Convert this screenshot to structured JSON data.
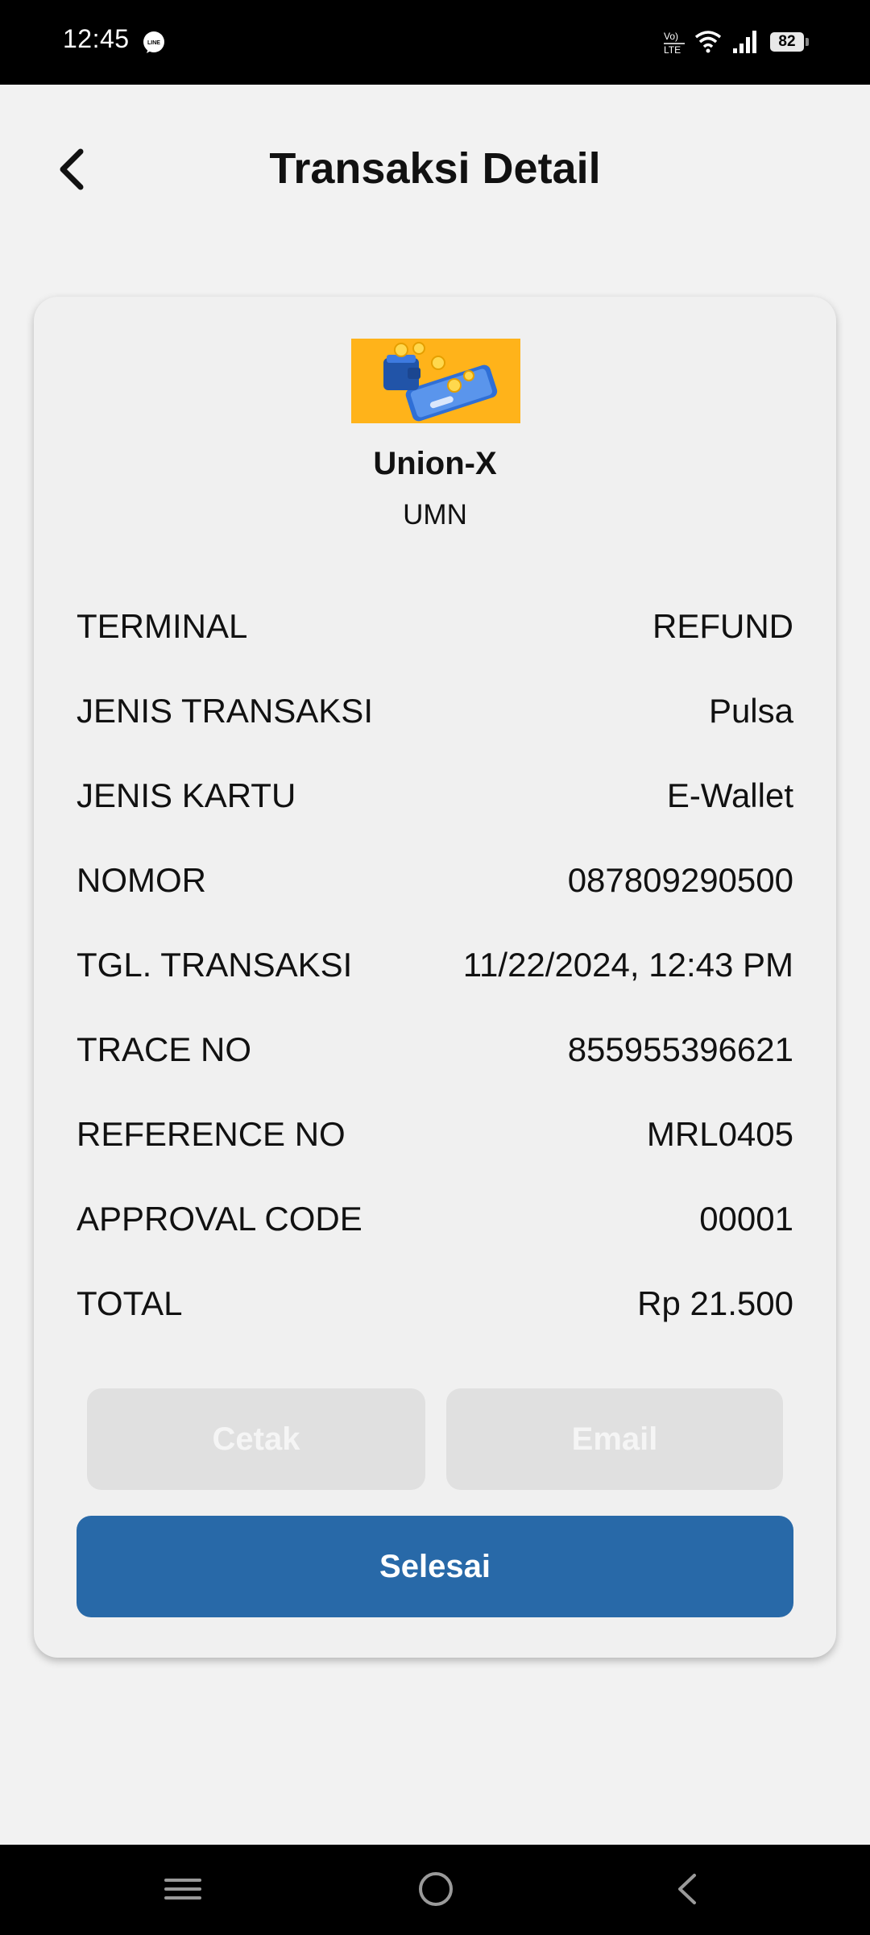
{
  "status_bar": {
    "time": "12:45",
    "battery": "82",
    "icons": [
      "line-app-icon",
      "volte-icon",
      "wifi-icon",
      "signal-icon",
      "battery-icon"
    ]
  },
  "header": {
    "title": "Transaksi Detail",
    "back_icon": "chevron-left-icon"
  },
  "merchant": {
    "name": "Union-X",
    "subtitle": "UMN",
    "logo": "wallet-phone-illustration"
  },
  "details": [
    {
      "label": "TERMINAL",
      "value": "REFUND"
    },
    {
      "label": "JENIS TRANSAKSI",
      "value": "Pulsa"
    },
    {
      "label": "JENIS KARTU",
      "value": "E-Wallet"
    },
    {
      "label": "NOMOR",
      "value": "087809290500"
    },
    {
      "label": "TGL. TRANSAKSI",
      "value": "11/22/2024, 12:43 PM"
    },
    {
      "label": "TRACE NO",
      "value": "855955396621"
    },
    {
      "label": "REFERENCE NO",
      "value": "MRL0405"
    },
    {
      "label": "APPROVAL CODE",
      "value": "00001"
    },
    {
      "label": "TOTAL",
      "value": "Rp 21.500"
    }
  ],
  "buttons": {
    "print": "Cetak",
    "email": "Email",
    "done": "Selesai"
  },
  "colors": {
    "primary": "#2869a8",
    "logo_bg": "#ffb31a",
    "disabled": "#e0e0e0"
  },
  "nav_bar": {
    "icons": [
      "menu-icon",
      "home-icon",
      "back-icon"
    ]
  }
}
